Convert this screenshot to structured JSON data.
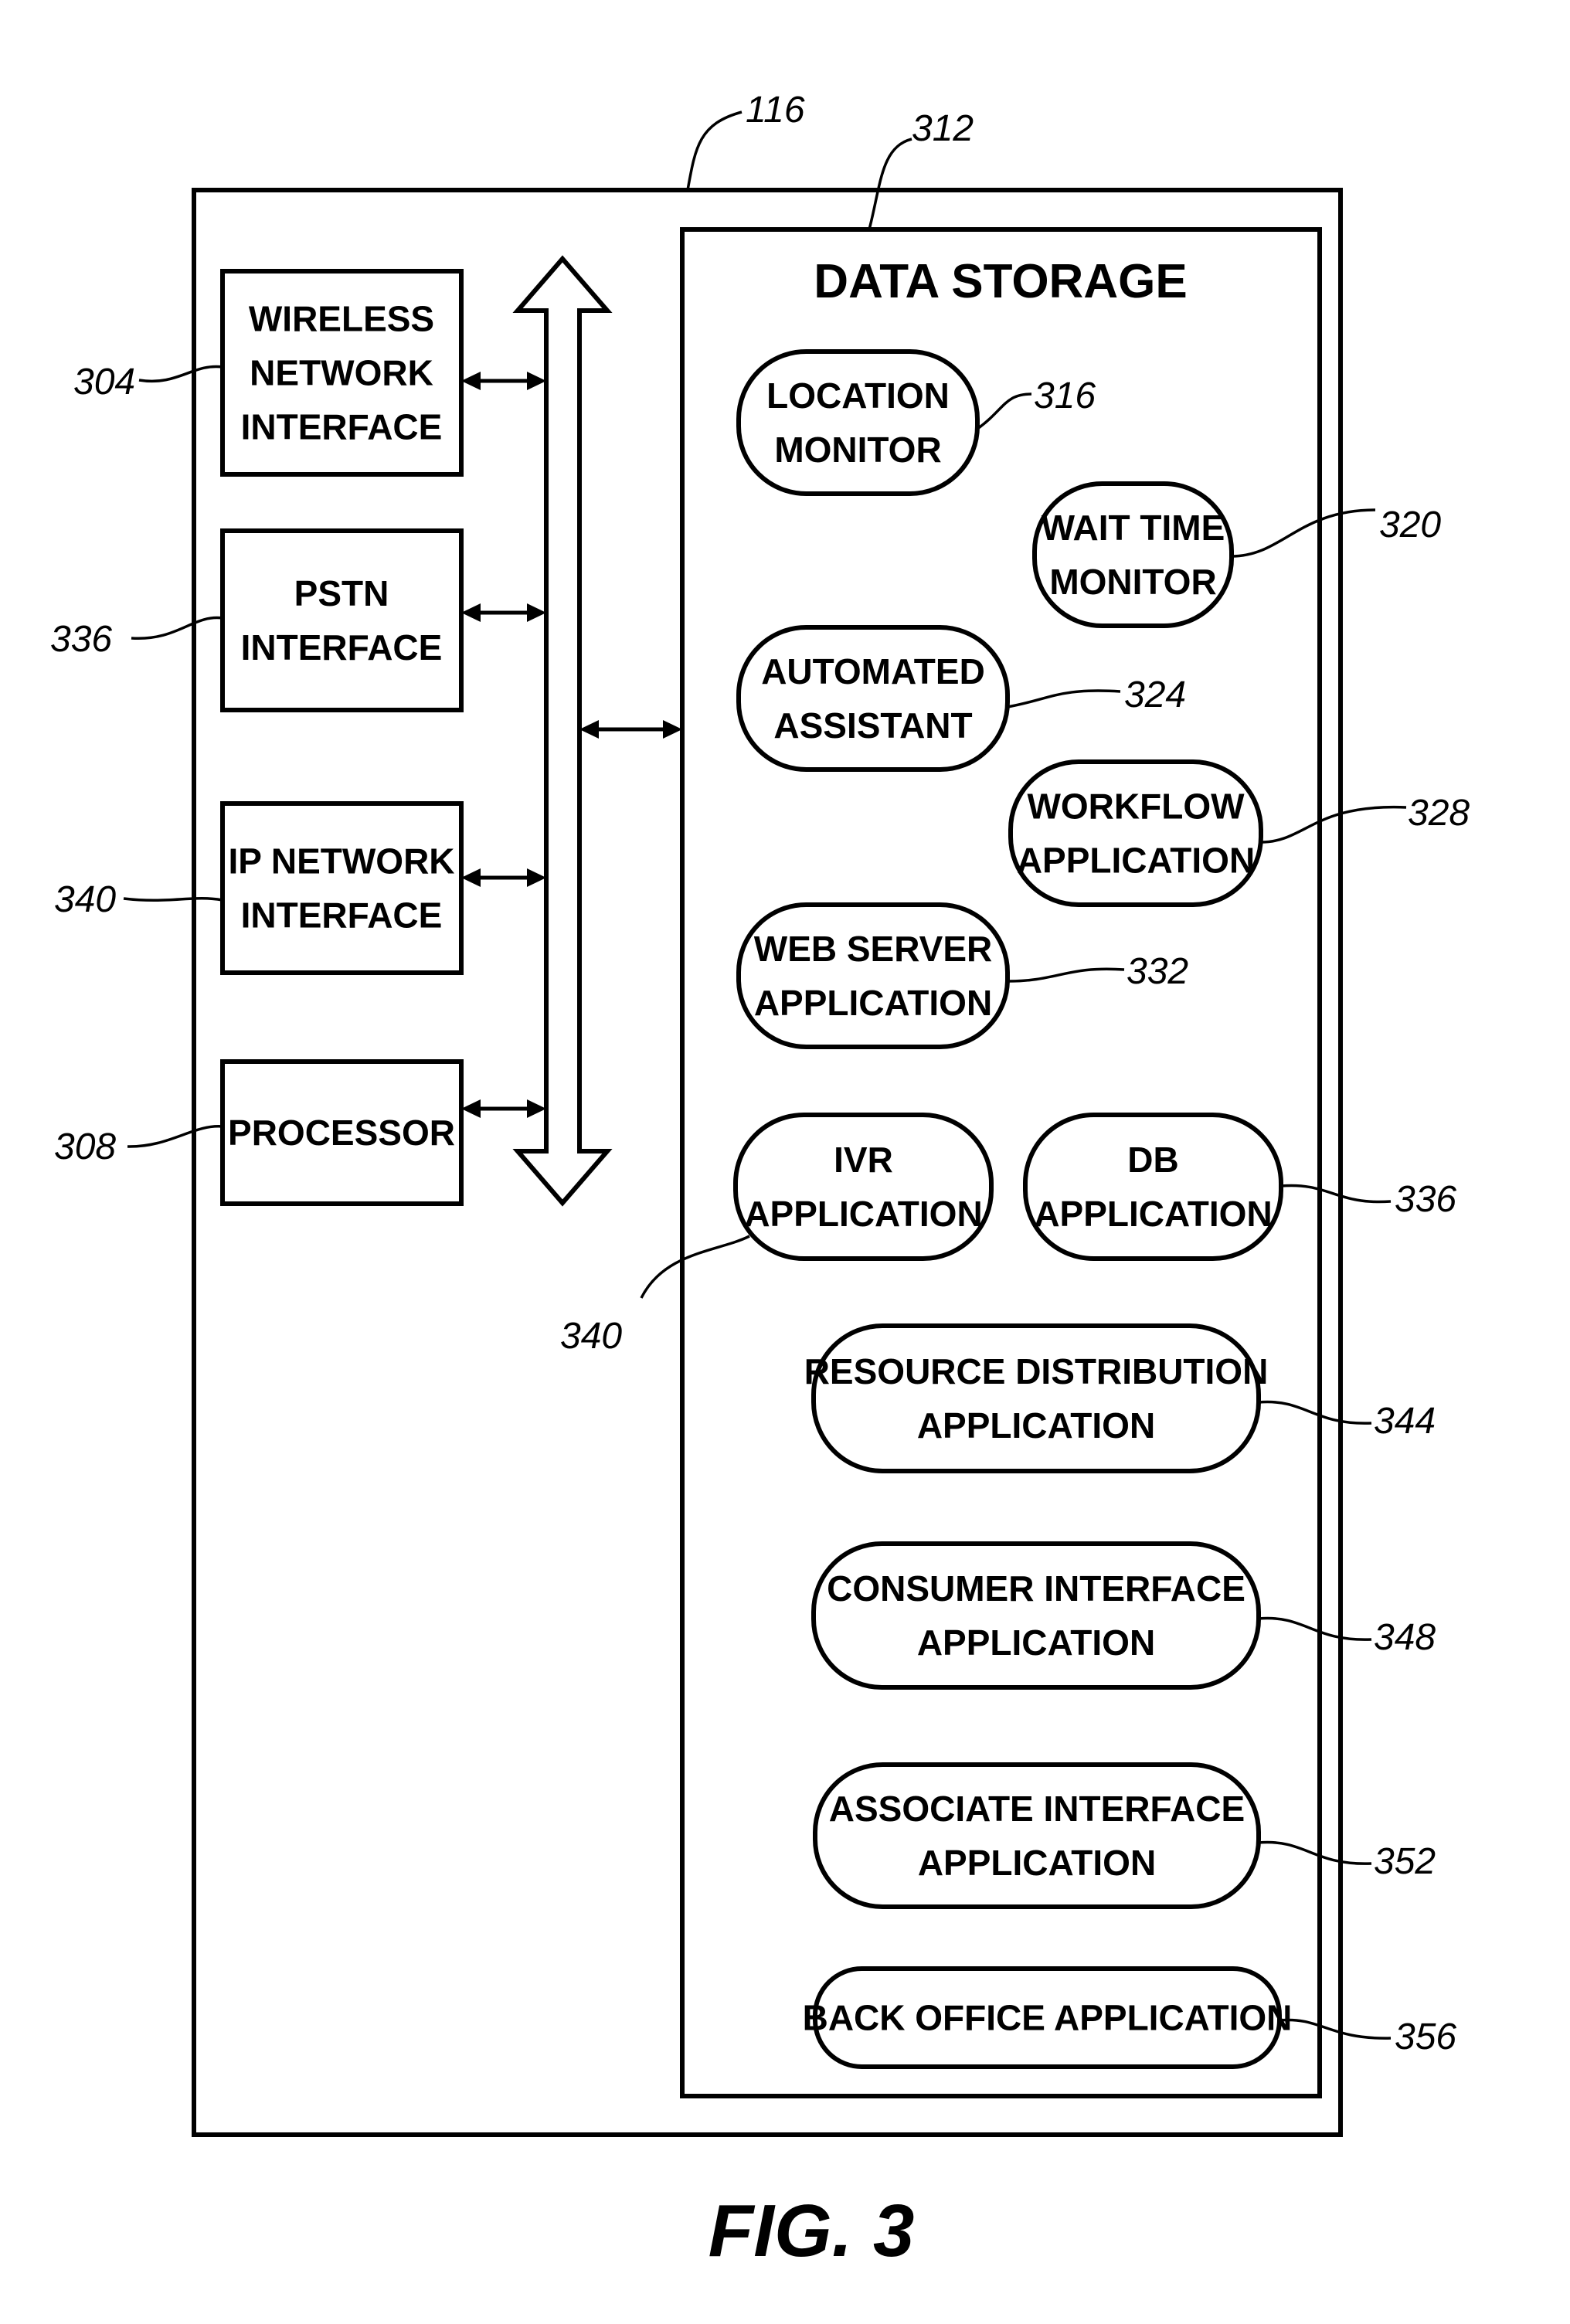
{
  "figure": {
    "caption": "FIG. 3",
    "system_ref": "116",
    "storage_ref": "312",
    "storage_title": "DATA STORAGE"
  },
  "left_blocks": [
    {
      "lines": [
        "WIRELESS",
        "NETWORK",
        "INTERFACE"
      ],
      "ref": "304"
    },
    {
      "lines": [
        "PSTN",
        "INTERFACE"
      ],
      "ref": "336"
    },
    {
      "lines": [
        "IP NETWORK",
        "INTERFACE"
      ],
      "ref": "340"
    },
    {
      "lines": [
        "PROCESSOR"
      ],
      "ref": "308"
    }
  ],
  "storage_items": [
    {
      "lines": [
        "LOCATION",
        "MONITOR"
      ],
      "ref": "316"
    },
    {
      "lines": [
        "WAIT TIME",
        "MONITOR"
      ],
      "ref": "320"
    },
    {
      "lines": [
        "AUTOMATED",
        "ASSISTANT"
      ],
      "ref": "324"
    },
    {
      "lines": [
        "WORKFLOW",
        "APPLICATION"
      ],
      "ref": "328"
    },
    {
      "lines": [
        "WEB SERVER",
        "APPLICATION"
      ],
      "ref": "332"
    },
    {
      "lines": [
        "IVR",
        "APPLICATION"
      ],
      "ref": "340"
    },
    {
      "lines": [
        "DB",
        "APPLICATION"
      ],
      "ref": "336"
    },
    {
      "lines": [
        "RESOURCE DISTRIBUTION",
        "APPLICATION"
      ],
      "ref": "344"
    },
    {
      "lines": [
        "CONSUMER INTERFACE",
        "APPLICATION"
      ],
      "ref": "348"
    },
    {
      "lines": [
        "ASSOCIATE INTERFACE",
        "APPLICATION"
      ],
      "ref": "352"
    },
    {
      "lines": [
        "BACK OFFICE APPLICATION"
      ],
      "ref": "356"
    }
  ]
}
